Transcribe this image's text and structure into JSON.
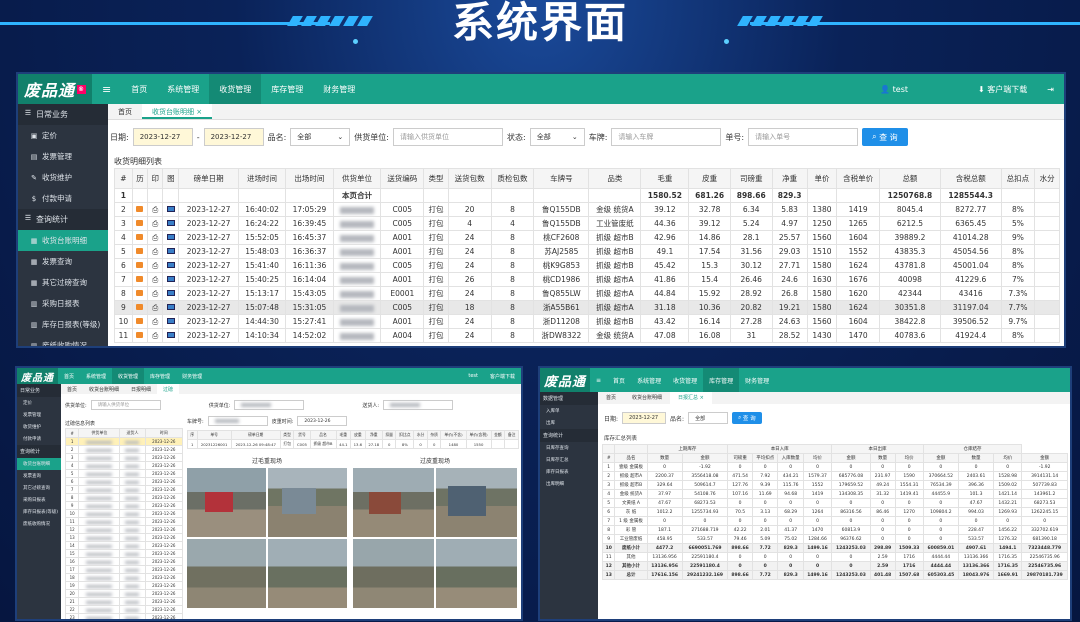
{
  "banner": {
    "title": "系统界面"
  },
  "main": {
    "logo": "废品通",
    "nav": [
      "首页",
      "系统管理",
      "收货管理",
      "库存管理",
      "财务管理"
    ],
    "user": "test",
    "download": "客户端下载",
    "sidebar": {
      "group1": "日常业务",
      "items1": [
        "定价",
        "发票管理",
        "收货维护",
        "付款申请"
      ],
      "group2": "查询统计",
      "items2": [
        "收货台账明细",
        "发票查询",
        "其它过磅查询",
        "采购日报表",
        "库存日报表(等级)",
        "废纸收购情况"
      ]
    },
    "tabs": [
      "首页",
      "收货台账明细 ×"
    ],
    "filters": {
      "date_label": "日期:",
      "date_from": "2023-12-27",
      "date_sep": "-",
      "date_to": "2023-12-27",
      "product_label": "品名:",
      "product_value": "全部",
      "supplier_label": "供货单位:",
      "supplier_placeholder": "请输入供货单位",
      "status_label": "状态:",
      "status_value": "全部",
      "plate_label": "车牌:",
      "plate_placeholder": "请输入车牌",
      "order_label": "单号:",
      "order_placeholder": "请输入单号",
      "query": "查 询"
    },
    "list_title": "收货明细列表",
    "columns": [
      "#",
      "历",
      "印",
      "图",
      "磅单日期",
      "进场时间",
      "出场时间",
      "供货单位",
      "送货编码",
      "类型",
      "送货包数",
      "质检包数",
      "车牌号",
      "品类",
      "毛重",
      "皮重",
      "司磅重",
      "净重",
      "单价",
      "含税单价",
      "总额",
      "含税总额",
      "总扣点",
      "水分"
    ],
    "total_row": {
      "no": "1",
      "label": "本页合计",
      "gross": "1580.52",
      "tare": "681.26",
      "scale": "898.66",
      "net": "829.3",
      "amount": "1250768.8",
      "tax_amount": "1285544.3"
    },
    "rows": [
      [
        "2",
        "2023-12-27",
        "16:40:02",
        "17:05:29",
        "C005",
        "打包",
        "20",
        "8",
        "鲁Q155DB",
        "金级 统货A",
        "39.12",
        "32.78",
        "6.34",
        "5.83",
        "1380",
        "1419",
        "8045.4",
        "8272.77",
        "8%"
      ],
      [
        "3",
        "2023-12-27",
        "16:24:22",
        "16:39:45",
        "C005",
        "打包",
        "4",
        "4",
        "鲁Q155DB",
        "工业管废纸",
        "44.36",
        "39.12",
        "5.24",
        "4.97",
        "1250",
        "1265",
        "6212.5",
        "6365.45",
        "5%"
      ],
      [
        "4",
        "2023-12-27",
        "15:52:05",
        "16:45:37",
        "A001",
        "打包",
        "24",
        "8",
        "桃CF2608",
        "抓级 超市B",
        "42.96",
        "14.86",
        "28.1",
        "25.57",
        "1560",
        "1604",
        "39889.2",
        "41014.28",
        "9%"
      ],
      [
        "5",
        "2023-12-27",
        "15:48:03",
        "16:36:37",
        "A001",
        "打包",
        "24",
        "8",
        "苏AJ2585",
        "抓级 超市B",
        "49.1",
        "17.54",
        "31.56",
        "29.03",
        "1510",
        "1552",
        "43835.3",
        "45054.56",
        "8%"
      ],
      [
        "6",
        "2023-12-27",
        "15:41:40",
        "16:11:36",
        "C005",
        "打包",
        "24",
        "8",
        "桃K9G853",
        "抓级 超市B",
        "45.42",
        "15.3",
        "30.12",
        "27.71",
        "1580",
        "1624",
        "43781.8",
        "45001.04",
        "8%"
      ],
      [
        "7",
        "2023-12-27",
        "15:40:25",
        "16:14:04",
        "A001",
        "打包",
        "26",
        "8",
        "桃CD1986",
        "抓级 超市A",
        "41.86",
        "15.4",
        "26.46",
        "24.6",
        "1630",
        "1676",
        "40098",
        "41229.6",
        "7%"
      ],
      [
        "8",
        "2023-12-27",
        "15:13:17",
        "15:43:05",
        "E0001",
        "打包",
        "24",
        "8",
        "鲁Q855LW",
        "抓级 超市A",
        "44.84",
        "15.92",
        "28.92",
        "26.8",
        "1580",
        "1620",
        "42344",
        "43416",
        "7.3%"
      ],
      [
        "9",
        "2023-12-27",
        "15:07:48",
        "15:31:05",
        "C005",
        "打包",
        "18",
        "8",
        "浙A55B61",
        "抓级 超市A",
        "31.18",
        "10.36",
        "20.82",
        "19.21",
        "1580",
        "1624",
        "30351.8",
        "31197.04",
        "7.7%"
      ],
      [
        "10",
        "2023-12-27",
        "14:44:30",
        "15:27:41",
        "A001",
        "打包",
        "24",
        "8",
        "浙D11208",
        "抓级 超市B",
        "43.42",
        "16.14",
        "27.28",
        "24.63",
        "1560",
        "1604",
        "38422.8",
        "39506.52",
        "9.7%"
      ],
      [
        "11",
        "2023-12-27",
        "14:10:34",
        "14:52:02",
        "A004",
        "打包",
        "24",
        "8",
        "浙DW8322",
        "金级 统货A",
        "47.08",
        "16.08",
        "31",
        "28.52",
        "1430",
        "1470",
        "40783.6",
        "41924.4",
        "8%"
      ]
    ]
  },
  "left_small": {
    "logo": "废品通",
    "nav": [
      "首页",
      "系统管理",
      "收货管理",
      "库存管理",
      "财务管理"
    ],
    "user": "test",
    "download": "客户端下载",
    "side": [
      "日常业务",
      "定价",
      "发票管理",
      "收货维护",
      "付款申请",
      "查询统计",
      "收货台账明细",
      "发票查询",
      "其它过磅查询",
      "采购日报表",
      "库存日报表(等级)",
      "废纸收购情况"
    ],
    "tabs": [
      "首页",
      "收货台账明细",
      "日报明细",
      "过磅"
    ],
    "supplier_label": "供货单位:",
    "supplier_placeholder": "请输入供货单位",
    "supplier2_label": "供货单位:",
    "plate_label": "送货人:",
    "vehicle_label": "车牌号:",
    "weigh_label": "皮重时间:",
    "weigh_value": "2023-12-26",
    "list_title": "过磅信息列表",
    "list_cols": [
      "#",
      "供货单位",
      "送货人",
      "时间"
    ],
    "list_dates": [
      "2023-12-26",
      "2023-12-26",
      "2023-12-26",
      "2023-12-26",
      "2023-12-26",
      "2023-12-26",
      "2023-12-26",
      "2023-12-26",
      "2023-12-26",
      "2023-12-26",
      "2023-12-26",
      "2023-12-26",
      "2023-12-26",
      "2023-12-26",
      "2023-12-26",
      "2023-12-26",
      "2023-12-26",
      "2023-12-26",
      "2023-12-26",
      "2023-12-26",
      "2023-12-26",
      "2023-12-26",
      "2023-12-26",
      "2023-12-26",
      "2023-12-26",
      "2023-12-26"
    ],
    "detail_cols": [
      "序",
      "单号",
      "磅单日期",
      "类型",
      "货号",
      "品名",
      "毛重",
      "皮重",
      "净重",
      "扣量",
      "扣比点",
      "水分",
      "杂质",
      "单价(不含)",
      "单价(含税)",
      "金额",
      "备注"
    ],
    "detail_row": [
      "1",
      "20231226001",
      "2023-12-26 09:48:47",
      "打包",
      "C005",
      "抓级 超市B",
      "44.1",
      "13.6",
      "27.18",
      "0",
      "8%",
      "0",
      "0",
      "1480",
      "1550",
      "",
      ""
    ],
    "photo_title_left": "过毛重现场",
    "photo_title_right": "过皮重现场"
  },
  "right_small": {
    "logo": "废品通",
    "nav": [
      "首页",
      "系统管理",
      "收货管理",
      "库存管理",
      "财务管理"
    ],
    "side": [
      "数据管理",
      "入库单",
      "出库",
      "查询统计",
      "日库存查询",
      "日库存汇总",
      "库存日报表",
      "出库明细"
    ],
    "tabs": [
      "首页",
      "收货台账明细",
      "日报汇总 ×"
    ],
    "date_label": "日期:",
    "date_value": "2023-12-27",
    "product_label": "品名:",
    "product_value": "全部",
    "query": "查 询",
    "list_title": "库存汇总列表",
    "group_headers": [
      "上期库存",
      "本日入库",
      "本日出库",
      "仓库结存"
    ],
    "columns": [
      "#",
      "品名",
      "数量",
      "金额",
      "司磅重",
      "平均扣点",
      "入库数量",
      "均价",
      "金额",
      "数量",
      "均价",
      "金额",
      "数量",
      "均价",
      "金额"
    ],
    "rows": [
      [
        "1",
        "壹级 金属板",
        "0",
        "-1.92",
        "0",
        "0",
        "0",
        "0",
        "0",
        "0",
        "0",
        "0",
        "0",
        "0",
        "-1.92"
      ],
      [
        "2",
        "抓级 超市A",
        "2200.37",
        "3556418.08",
        "471.54",
        "7.92",
        "434.21",
        "1579.37",
        "685776.08",
        "231.97",
        "1590",
        "370664.52",
        "2403.61",
        "1528.98",
        "3914131.14"
      ],
      [
        "3",
        "抓级 超市B",
        "329.64",
        "509614.7",
        "127.76",
        "9.39",
        "115.76",
        "1552",
        "179659.52",
        "49.24",
        "1554.31",
        "76534.39",
        "396.36",
        "1509.02",
        "507739.83"
      ],
      [
        "4",
        "金级 统货A",
        "37.97",
        "54108.76",
        "107.16",
        "11.69",
        "94.68",
        "1419",
        "134308.35",
        "31.32",
        "1419.41",
        "44455.9",
        "101.3",
        "1421.14",
        "143961.2"
      ],
      [
        "5",
        "文黄纸 A",
        "47.67",
        "68273.53",
        "0",
        "0",
        "0",
        "0",
        "0",
        "0",
        "0",
        "0",
        "47.67",
        "1432.21",
        "68273.53"
      ],
      [
        "6",
        "灰 纸",
        "1012.2",
        "1255734.93",
        "70.5",
        "3.13",
        "68.29",
        "1264",
        "86316.56",
        "86.46",
        "1270",
        "109804.2",
        "994.03",
        "1269.93",
        "1262245.15"
      ],
      [
        "7",
        "1 级 金属板",
        "0",
        "0",
        "0",
        "0",
        "0",
        "0",
        "0",
        "0",
        "0",
        "0",
        "0",
        "0",
        "0"
      ],
      [
        "8",
        "彩 管",
        "187.1",
        "271688.719",
        "42.22",
        "2.01",
        "41.37",
        "1470",
        "60813.9",
        "0",
        "0",
        "0",
        "228.47",
        "1456.22",
        "332702.619"
      ],
      [
        "9",
        "工业管废纸",
        "458.95",
        "533.57",
        "79.46",
        "5.09",
        "75.02",
        "1284.66",
        "96376.62",
        "0",
        "0",
        "0",
        "533.57",
        "1276.32",
        "681390.18"
      ],
      [
        "10",
        "废纸小计",
        "4477.2",
        "6690051.769",
        "898.66",
        "7.72",
        "829.3",
        "1499.16",
        "1243253.03",
        "298.89",
        "1509.33",
        "600859.01",
        "4907.61",
        "1494.1",
        "7323448.779"
      ],
      [
        "11",
        "其他",
        "13136.956",
        "22591180.4",
        "0",
        "0",
        "0",
        "0",
        "0",
        "2.59",
        "1716",
        "4444.44",
        "13136.366",
        "1716.35",
        "22546735.96"
      ],
      [
        "12",
        "其他小计",
        "13136.956",
        "22591180.4",
        "0",
        "0",
        "0",
        "0",
        "0",
        "2.59",
        "1716",
        "4444.44",
        "13136.366",
        "1716.35",
        "22546735.96"
      ],
      [
        "13",
        "总计",
        "17616.156",
        "29241232.169",
        "898.66",
        "7.72",
        "829.3",
        "1499.16",
        "1243253.03",
        "401.48",
        "1507.68",
        "605303.45",
        "18043.976",
        "1669.91",
        "29870181.739"
      ]
    ]
  }
}
